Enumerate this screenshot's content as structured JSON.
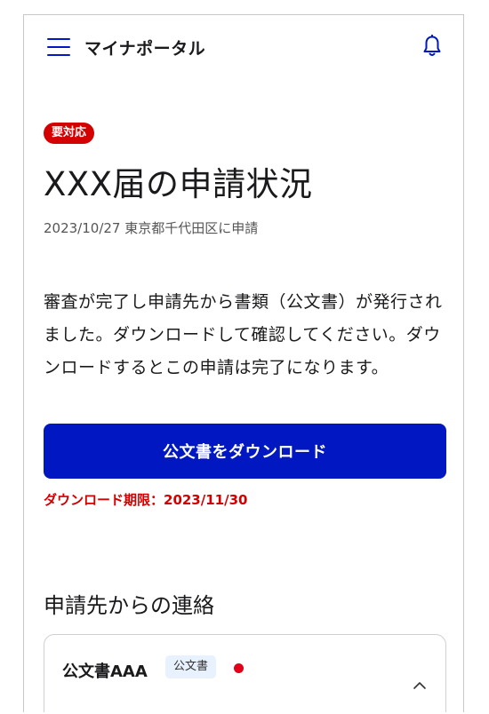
{
  "header": {
    "app_title": "マイナポータル",
    "menu_icon": "hamburger-menu-icon",
    "notification_icon": "bell-icon"
  },
  "status": {
    "badge": "要対応"
  },
  "page": {
    "title": "XXX届の申請状況",
    "subtitle": "2023/10/27 東京都千代田区に申請",
    "message": "審査が完了し申請先から書類（公文書）が発行されました。ダウンロードして確認してください。ダウンロードするとこの申請は完了になります。"
  },
  "download": {
    "button_label": "公文書をダウンロード",
    "deadline": "ダウンロード期限：2023/11/30"
  },
  "contacts": {
    "section_title": "申請先からの連絡",
    "items": [
      {
        "title": "公文書AAA",
        "tag": "公文書",
        "unread": true
      }
    ]
  },
  "colors": {
    "primary": "#0017c1",
    "alert": "#d40000",
    "tag_bg": "#e8f1fe"
  }
}
